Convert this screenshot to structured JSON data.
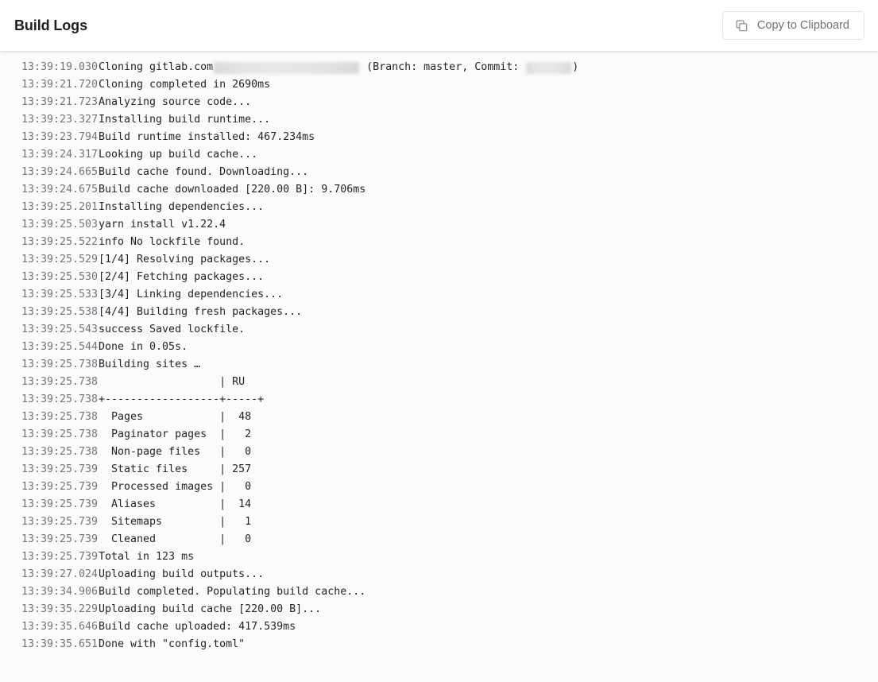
{
  "header": {
    "title": "Build Logs",
    "copy_button": {
      "label": "Copy to Clipboard",
      "icon": "copy-icon"
    }
  },
  "log": {
    "lines": [
      {
        "ts": "13:39:19.030",
        "pre": "Cloning gitlab.com",
        "redactions": [
          "repo",
          "commit"
        ],
        "mid": " (Branch: master, Commit: ",
        "post": ")"
      },
      {
        "ts": "13:39:21.720",
        "msg": "Cloning completed in 2690ms"
      },
      {
        "ts": "13:39:21.723",
        "msg": "Analyzing source code..."
      },
      {
        "ts": "13:39:23.327",
        "msg": "Installing build runtime..."
      },
      {
        "ts": "13:39:23.794",
        "msg": "Build runtime installed: 467.234ms"
      },
      {
        "ts": "13:39:24.317",
        "msg": "Looking up build cache..."
      },
      {
        "ts": "13:39:24.665",
        "msg": "Build cache found. Downloading..."
      },
      {
        "ts": "13:39:24.675",
        "msg": "Build cache downloaded [220.00 B]: 9.706ms"
      },
      {
        "ts": "13:39:25.201",
        "msg": "Installing dependencies..."
      },
      {
        "ts": "13:39:25.503",
        "msg": "yarn install v1.22.4"
      },
      {
        "ts": "13:39:25.522",
        "msg": "info No lockfile found."
      },
      {
        "ts": "13:39:25.529",
        "msg": "[1/4] Resolving packages..."
      },
      {
        "ts": "13:39:25.530",
        "msg": "[2/4] Fetching packages..."
      },
      {
        "ts": "13:39:25.533",
        "msg": "[3/4] Linking dependencies..."
      },
      {
        "ts": "13:39:25.538",
        "msg": "[4/4] Building fresh packages..."
      },
      {
        "ts": "13:39:25.543",
        "msg": "success Saved lockfile."
      },
      {
        "ts": "13:39:25.544",
        "msg": "Done in 0.05s."
      },
      {
        "ts": "13:39:25.738",
        "msg": "Building sites …"
      },
      {
        "ts": "13:39:25.738",
        "msg": "                   | RU"
      },
      {
        "ts": "13:39:25.738",
        "msg": "+------------------+-----+"
      },
      {
        "ts": "13:39:25.738",
        "msg": "  Pages            |  48"
      },
      {
        "ts": "13:39:25.738",
        "msg": "  Paginator pages  |   2"
      },
      {
        "ts": "13:39:25.738",
        "msg": "  Non-page files   |   0"
      },
      {
        "ts": "13:39:25.739",
        "msg": "  Static files     | 257"
      },
      {
        "ts": "13:39:25.739",
        "msg": "  Processed images |   0"
      },
      {
        "ts": "13:39:25.739",
        "msg": "  Aliases          |  14"
      },
      {
        "ts": "13:39:25.739",
        "msg": "  Sitemaps         |   1"
      },
      {
        "ts": "13:39:25.739",
        "msg": "  Cleaned          |   0"
      },
      {
        "ts": "13:39:25.739",
        "msg": "Total in 123 ms"
      },
      {
        "ts": "13:39:27.024",
        "msg": "Uploading build outputs..."
      },
      {
        "ts": "13:39:34.906",
        "msg": "Build completed. Populating build cache..."
      },
      {
        "ts": "13:39:35.229",
        "msg": "Uploading build cache [220.00 B]..."
      },
      {
        "ts": "13:39:35.646",
        "msg": "Build cache uploaded: 417.539ms"
      },
      {
        "ts": "13:39:35.651",
        "msg": "Done with \"config.toml\""
      }
    ],
    "build_summary": {
      "columns": [
        "",
        "RU"
      ],
      "rows": [
        {
          "label": "Pages",
          "value": "48"
        },
        {
          "label": "Paginator pages",
          "value": "2"
        },
        {
          "label": "Non-page files",
          "value": "0"
        },
        {
          "label": "Static files",
          "value": "257"
        },
        {
          "label": "Processed images",
          "value": "0"
        },
        {
          "label": "Aliases",
          "value": "14"
        },
        {
          "label": "Sitemaps",
          "value": "1"
        },
        {
          "label": "Cleaned",
          "value": "0"
        }
      ],
      "total": "Total in 123 ms"
    }
  },
  "colors": {
    "page_background": "#fbfbfb",
    "header_background": "#ffffff",
    "title_text": "#1b1f23",
    "timestamp_text": "#6f7680",
    "message_text": "#1f2328",
    "button_border": "#e3e4e8",
    "button_text": "#6b7280",
    "icon": "#8c8c9c"
  }
}
